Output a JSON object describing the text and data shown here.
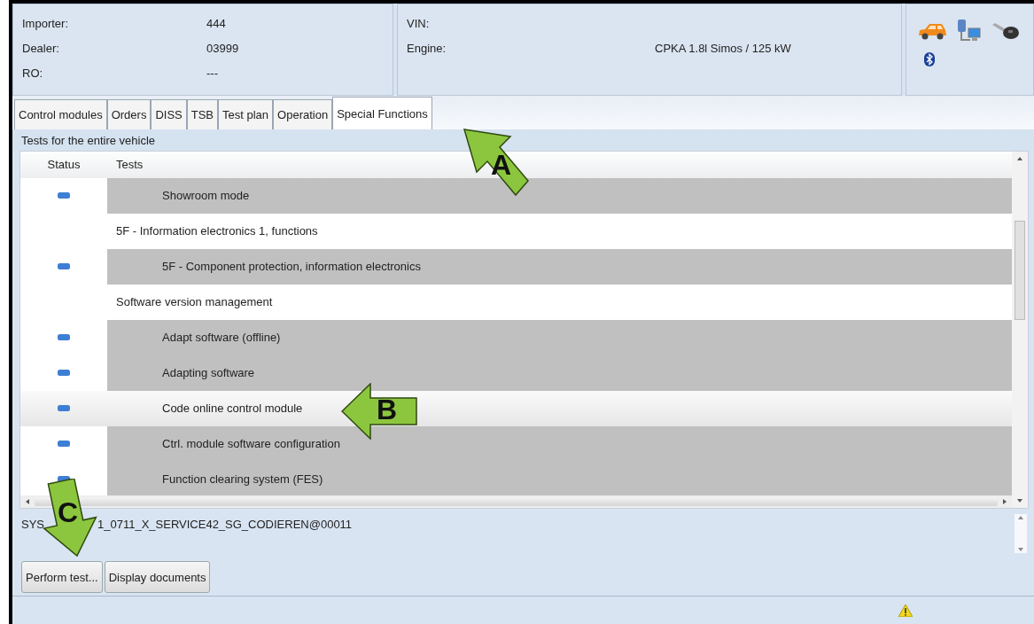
{
  "vehicle_info": {
    "fields": [
      {
        "label": "Importer:",
        "value": "444"
      },
      {
        "label": "Dealer:",
        "value": "03999"
      },
      {
        "label": "RO:",
        "value": "---"
      }
    ],
    "vin_label": "VIN:",
    "engine_label": "Engine:",
    "engine_value": "CPKA 1.8l Simos / 125 kW"
  },
  "tabs": [
    {
      "label": "Control modules",
      "selected": false
    },
    {
      "label": "Orders",
      "selected": false
    },
    {
      "label": "DISS",
      "selected": false
    },
    {
      "label": "TSB",
      "selected": false
    },
    {
      "label": "Test plan",
      "selected": false
    },
    {
      "label": "Operation",
      "selected": false
    },
    {
      "label": "Special Functions",
      "selected": true
    }
  ],
  "caption": "Tests for the entire vehicle",
  "table": {
    "columns": [
      "Status",
      "Tests"
    ],
    "rows": [
      {
        "kind": "test",
        "name": "Showroom mode",
        "selected": false
      },
      {
        "kind": "group",
        "name": "5F - Information electronics 1, functions",
        "selected": false
      },
      {
        "kind": "test",
        "name": "5F - Component protection, information electronics",
        "selected": false
      },
      {
        "kind": "group",
        "name": "Software version management",
        "selected": false
      },
      {
        "kind": "test",
        "name": "Adapt software (offline)",
        "selected": false
      },
      {
        "kind": "test",
        "name": "Adapting software",
        "selected": false
      },
      {
        "kind": "test",
        "name": "Code online control module",
        "selected": true
      },
      {
        "kind": "test",
        "name": "Ctrl. module software configuration",
        "selected": false
      },
      {
        "kind": "test",
        "name": "Function clearing system (FES)",
        "selected": false
      }
    ]
  },
  "info_text": [
    "SYS",
    "1_0711_X_SERVICE42_SG_CODIEREN@00011"
  ],
  "buttons": [
    "Perform test...",
    "Display documents"
  ],
  "annotations": [
    {
      "kind": "up",
      "label": "A"
    },
    {
      "kind": "left",
      "label": "B"
    },
    {
      "kind": "down",
      "label": "C"
    }
  ]
}
